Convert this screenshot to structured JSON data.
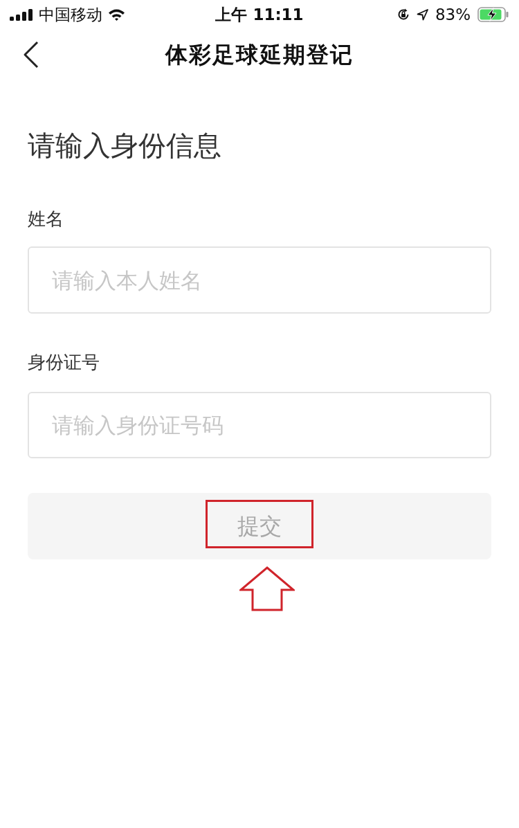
{
  "status_bar": {
    "carrier": "中国移动",
    "time": "上午 11:11",
    "battery": "83%"
  },
  "nav": {
    "title": "体彩足球延期登记"
  },
  "form": {
    "heading": "请输入身份信息",
    "fields": [
      {
        "label": "姓名",
        "placeholder": "请输入本人姓名"
      },
      {
        "label": "身份证号",
        "placeholder": "请输入身份证号码"
      }
    ],
    "submit": {
      "label": "提交",
      "disabled": true
    }
  }
}
